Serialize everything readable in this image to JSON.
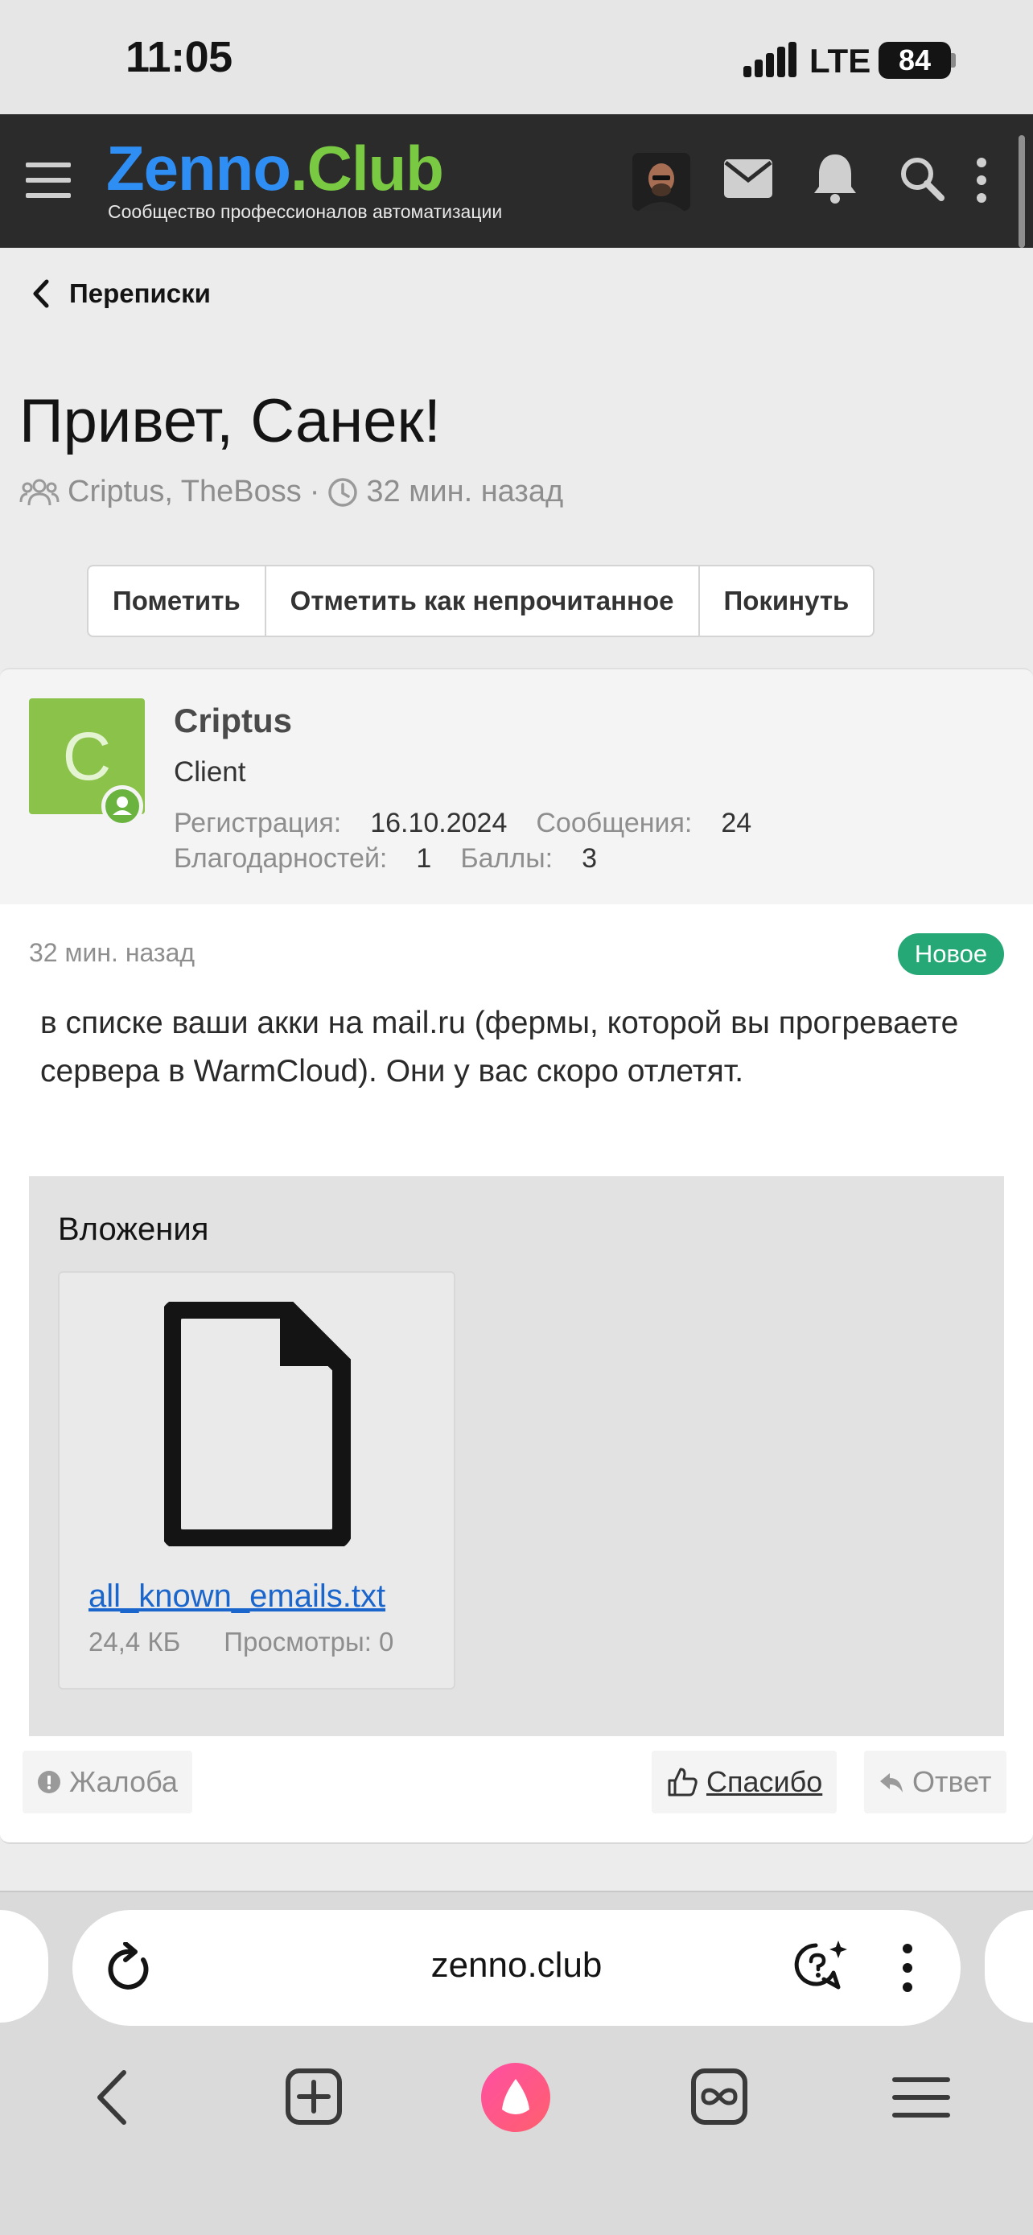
{
  "status_bar": {
    "time": "11:05",
    "network": "LTE",
    "battery": "84"
  },
  "header": {
    "logo_part1": "Zenno",
    "logo_part2": ".Club",
    "tagline": "Сообщество профессионалов автоматизации",
    "icons": [
      "hamburger-icon",
      "avatar",
      "mail-icon",
      "bell-icon",
      "search-icon",
      "more-vertical-icon"
    ]
  },
  "breadcrumb": {
    "label": "Переписки"
  },
  "conversation": {
    "title": "Привет, Санек!",
    "participants": "Criptus, TheBoss",
    "separator": "·",
    "time": "32 мин. назад"
  },
  "actions": {
    "mark": "Пометить",
    "mark_unread": "Отметить как непрочитанное",
    "leave": "Покинуть"
  },
  "message": {
    "author": {
      "initial": "C",
      "name": "Criptus",
      "role": "Client",
      "reg_label": "Регистрация:",
      "reg_value": "16.10.2024",
      "msgs_label": "Сообщения:",
      "msgs_value": "24",
      "thanks_label": "Благодарностей:",
      "thanks_value": "1",
      "points_label": "Баллы:",
      "points_value": "3"
    },
    "time": "32 мин. назад",
    "badge": "Новое",
    "text": "в списке ваши акки на mail.ru (фермы, которой вы прогреваете сервера в WarmCloud). Они у вас скоро отлетят.",
    "attachments_title": "Вложения",
    "attachment": {
      "name": "all_known_emails.txt",
      "size": "24,4 КБ",
      "views": "Просмотры: 0"
    },
    "report": "Жалоба",
    "thanks": "Спасибо",
    "reply": "Ответ"
  },
  "browser": {
    "url": "zenno.club"
  },
  "colors": {
    "header_bg": "#2b2b2b",
    "logo_blue": "#2f8ef4",
    "logo_green": "#7ac943",
    "badge_green": "#25a876",
    "avatar_green": "#8bc34a",
    "link_blue": "#1a66cc"
  }
}
